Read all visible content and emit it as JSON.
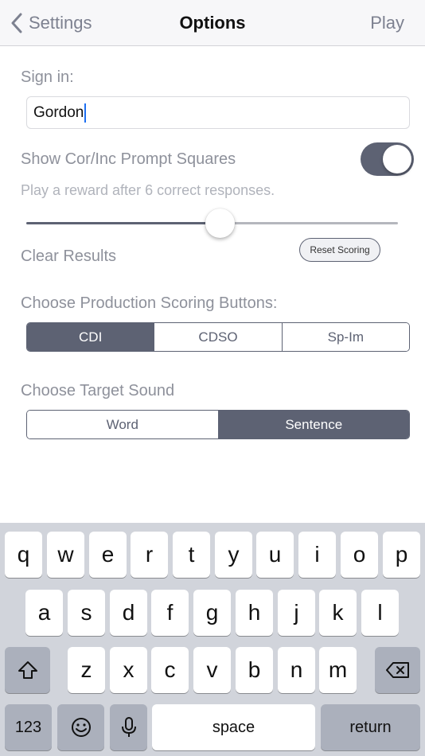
{
  "nav": {
    "back_label": "Settings",
    "title": "Options",
    "play_label": "Play"
  },
  "sign_in": {
    "label": "Sign in:",
    "value": "Gordon"
  },
  "prompt_squares": {
    "label": "Show Cor/Inc Prompt Squares",
    "enabled": true
  },
  "reward": {
    "text": "Play a reward after 6 correct responses.",
    "slider_fraction": 0.52
  },
  "clear_results": {
    "label": "Clear Results",
    "button_label": "Reset Scoring"
  },
  "scoring_buttons": {
    "label": "Choose Production Scoring Buttons:",
    "options": [
      "CDI",
      "CDSO",
      "Sp-Im"
    ],
    "selected": "CDI"
  },
  "target_sound": {
    "label": "Choose Target Sound",
    "options": [
      "Word",
      "Sentence"
    ],
    "selected": "Sentence"
  },
  "keyboard": {
    "row1": [
      "q",
      "w",
      "e",
      "r",
      "t",
      "y",
      "u",
      "i",
      "o",
      "p"
    ],
    "row2": [
      "a",
      "s",
      "d",
      "f",
      "g",
      "h",
      "j",
      "k",
      "l"
    ],
    "row3": [
      "z",
      "x",
      "c",
      "v",
      "b",
      "n",
      "m"
    ],
    "numbers_label": "123",
    "space_label": "space",
    "return_label": "return"
  },
  "colors": {
    "accent": "#5d6273",
    "label": "#8e919b",
    "hint": "#b0b3bb",
    "keyboard_bg": "#d1d4db",
    "cursor": "#1d6ff2"
  },
  "icons": {
    "back": "chevron-left-icon",
    "shift": "shift-icon",
    "delete": "backspace-icon",
    "emoji": "emoji-icon",
    "mic": "microphone-icon"
  }
}
